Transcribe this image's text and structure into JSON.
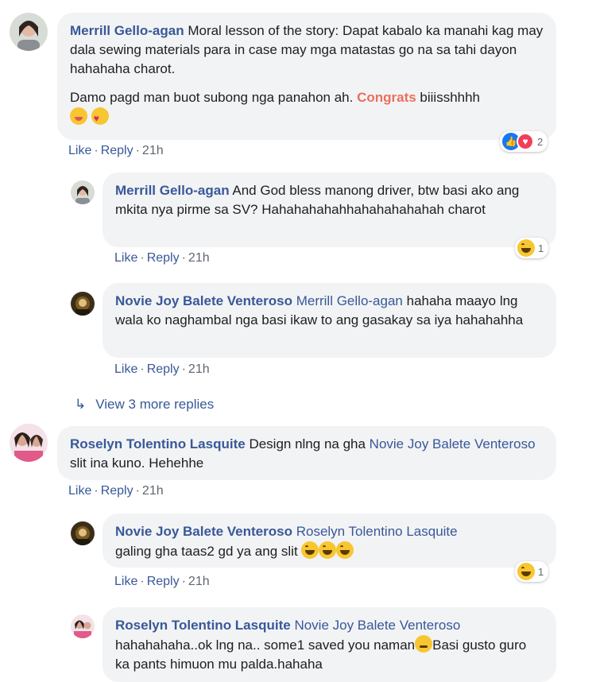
{
  "comments": [
    {
      "author": "Merrill Gello-agan",
      "text1": "Moral lesson of the story: Dapat kabalo ka manahi kag may dala sewing materials para in case may mga matastas go na sa tahi dayon hahahaha charot.",
      "text2_pre": "Damo pagd man buot subong nga panahon ah. ",
      "highlight": "Congrats",
      "text2_post": " biiisshhhh",
      "actions": {
        "like": "Like",
        "reply": "Reply",
        "time": "21h"
      },
      "reaction_count": "2"
    },
    {
      "author": "Merrill Gello-agan",
      "text": "And God bless manong driver, btw basi ako ang mkita nya pirme sa SV? Hahahahahahhahahahahahah charot",
      "actions": {
        "like": "Like",
        "reply": "Reply",
        "time": "21h"
      },
      "reaction_count": "1"
    },
    {
      "author": "Novie Joy Balete Venteroso",
      "mention": "Merrill Gello-agan",
      "text": " hahaha maayo lng wala ko naghambal nga basi ikaw to ang gasakay sa iya hahahahha",
      "actions": {
        "like": "Like",
        "reply": "Reply",
        "time": "21h"
      }
    },
    {
      "view_more": "View 3 more replies"
    },
    {
      "author": "Roselyn Tolentino Lasquite",
      "text_pre": "Design nlng na gha ",
      "mention": "Novie Joy Balete Venteroso",
      "text_post": " slit ina kuno. Hehehhe",
      "actions": {
        "like": "Like",
        "reply": "Reply",
        "time": "21h"
      }
    },
    {
      "author": "Novie Joy Balete Venteroso",
      "mention": "Roselyn Tolentino Lasquite",
      "text": "galing gha taas2 gd ya ang slit",
      "actions": {
        "like": "Like",
        "reply": "Reply",
        "time": "21h"
      },
      "reaction_count": "1"
    },
    {
      "author": "Roselyn Tolentino Lasquite",
      "mention": "Novie Joy Balete Venteroso",
      "text1": "hahahahaha..ok lng na.. some1 saved you naman",
      "text2": "Basi gusto guro ka pants himuon mu palda.hahaha"
    }
  ],
  "colors": {
    "link": "#385898",
    "bubble": "#f2f3f5",
    "meta": "#606770",
    "congrats": "#e9705c"
  }
}
